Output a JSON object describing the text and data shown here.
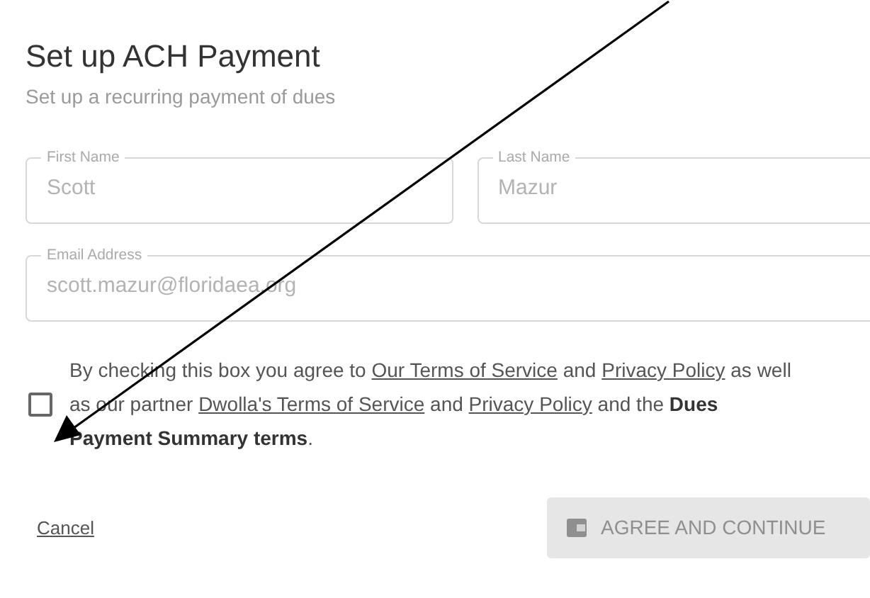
{
  "title": "Set up ACH Payment",
  "subtitle": "Set up a recurring payment of dues",
  "field_rows": [
    [
      {
        "label": "First Name",
        "value": "Scott"
      },
      {
        "label": "Last Name",
        "value": "Mazur"
      }
    ],
    [
      {
        "label": "Email Address",
        "value": "scott.mazur@floridaea.org"
      }
    ]
  ],
  "consent": {
    "checked": false,
    "parts": [
      {
        "kind": "text",
        "text": "By checking this box you agree to "
      },
      {
        "kind": "link",
        "text": "Our Terms of Service"
      },
      {
        "kind": "text",
        "text": " and "
      },
      {
        "kind": "link",
        "text": "Privacy Policy"
      },
      {
        "kind": "text",
        "text": " as well as our partner "
      },
      {
        "kind": "link",
        "text": "Dwolla's Terms of Service"
      },
      {
        "kind": "text",
        "text": " and "
      },
      {
        "kind": "link",
        "text": "Privacy Policy"
      },
      {
        "kind": "text",
        "text": " and the "
      },
      {
        "kind": "bold",
        "text": "Dues Payment Summary terms"
      },
      {
        "kind": "text",
        "text": "."
      }
    ]
  },
  "cancel": "Cancel",
  "submit": {
    "label": "AGREE AND CONTINUE",
    "disabled": true
  }
}
